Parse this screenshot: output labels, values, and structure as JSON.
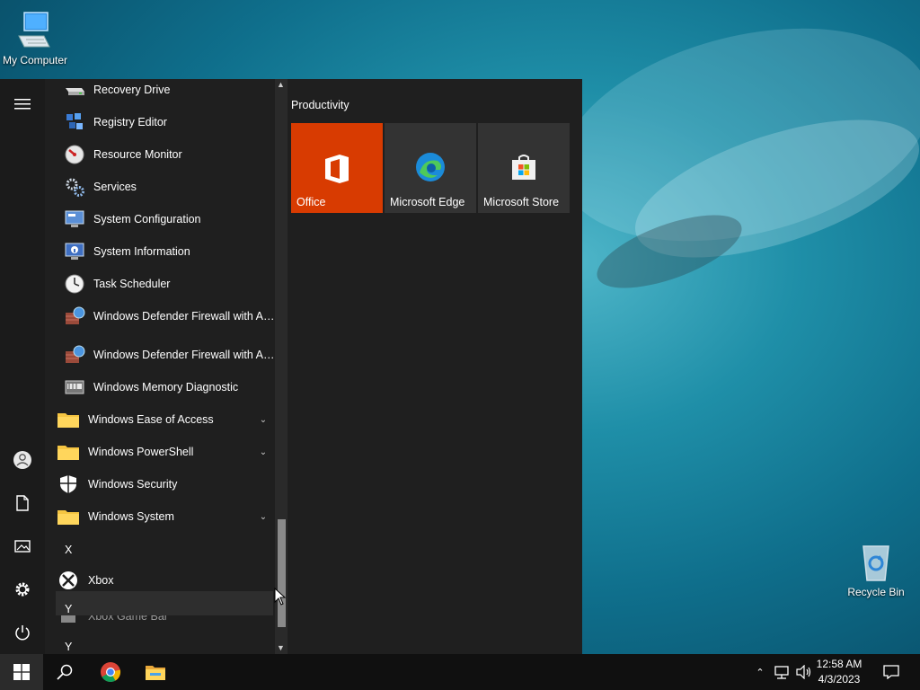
{
  "desktop": {
    "icons": [
      {
        "label": "My Computer"
      },
      {
        "label": "Recycle Bin"
      }
    ]
  },
  "start_menu": {
    "apps": [
      {
        "label": "Recovery Drive",
        "icon": "drive-icon"
      },
      {
        "label": "Registry Editor",
        "icon": "registry-icon"
      },
      {
        "label": "Resource Monitor",
        "icon": "monitor-gauge-icon"
      },
      {
        "label": "Services",
        "icon": "gears-icon"
      },
      {
        "label": "System Configuration",
        "icon": "system-config-icon"
      },
      {
        "label": "System Information",
        "icon": "system-info-icon"
      },
      {
        "label": "Task Scheduler",
        "icon": "clock-icon"
      },
      {
        "label": "Windows Defender Firewall with Ad...",
        "icon": "firewall-icon"
      },
      {
        "label": "Windows Defender Firewall with Ad...",
        "icon": "firewall-icon"
      },
      {
        "label": "Windows Memory Diagnostic",
        "icon": "memory-chip-icon"
      }
    ],
    "folders": [
      {
        "label": "Windows Ease of Access"
      },
      {
        "label": "Windows PowerShell"
      },
      {
        "label": "Windows Security",
        "icon": "shield-icon"
      },
      {
        "label": "Windows System"
      }
    ],
    "letter_x": "X",
    "xbox": {
      "label": "Xbox"
    },
    "xbox_game_bar": {
      "label": "Xbox Game Bar"
    },
    "letter_y_hover": "Y",
    "letter_y": "Y",
    "tiles_group": "Productivity",
    "tiles": [
      {
        "label": "Office",
        "color": "#d83b01"
      },
      {
        "label": "Microsoft Edge",
        "color": "#333333"
      },
      {
        "label": "Microsoft Store",
        "color": "#333333"
      }
    ]
  },
  "taskbar": {
    "time": "12:58 AM",
    "date": "4/3/2023"
  }
}
